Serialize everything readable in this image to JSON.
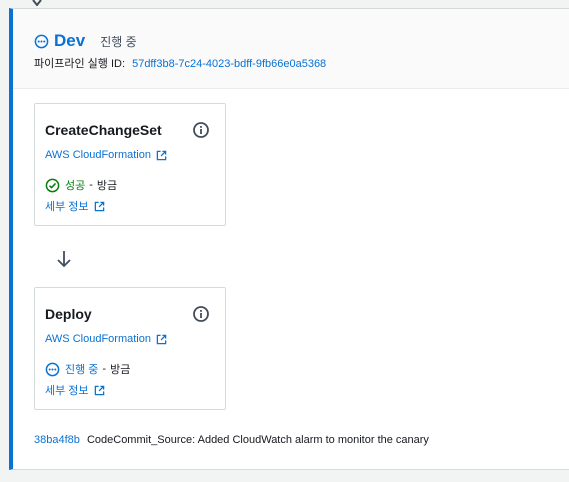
{
  "stage": {
    "name": "Dev",
    "status": "진행 중",
    "execution_label": "파이프라인 실행 ID:",
    "execution_id": "57dff3b8-7c24-4023-bdff-9fb66e0a5368"
  },
  "actions": [
    {
      "name": "CreateChangeSet",
      "provider": "AWS CloudFormation",
      "status": "성공",
      "status_color": "#037f0c",
      "time": "방금",
      "details": "세부 정보"
    },
    {
      "name": "Deploy",
      "provider": "AWS CloudFormation",
      "status": "진행 중",
      "status_color": "#0972d3",
      "time": "방금",
      "details": "세부 정보"
    }
  ],
  "commit": {
    "hash": "38ba4f8b",
    "message": "CodeCommit_Source: Added CloudWatch alarm to monitor the canary"
  },
  "colors": {
    "accent": "#0972d3",
    "success": "#037f0c"
  }
}
